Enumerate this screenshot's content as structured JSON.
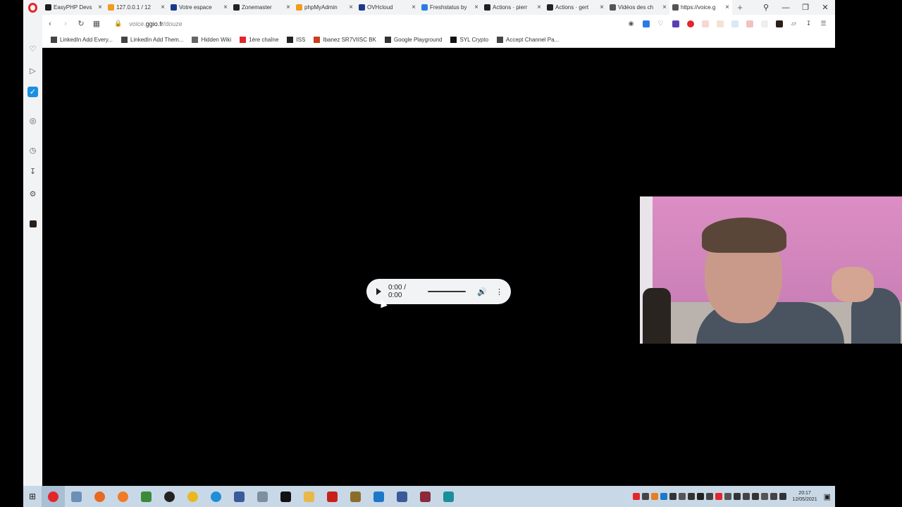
{
  "tabs": [
    {
      "label": "EasyPHP Devs",
      "color": "#1c1c1c",
      "active": false
    },
    {
      "label": "127.0.0.1 / 12",
      "color": "#f29b1d",
      "active": false
    },
    {
      "label": "Votre espace",
      "color": "#1b3a8a",
      "active": false
    },
    {
      "label": "Zonemaster",
      "color": "#222222",
      "active": false
    },
    {
      "label": "phpMyAdmin",
      "color": "#f29b1d",
      "active": false
    },
    {
      "label": "OVHcloud",
      "color": "#1b3a8a",
      "active": false
    },
    {
      "label": "Freshstatus by",
      "color": "#2c7be5",
      "active": false
    },
    {
      "label": "Actions · pierr",
      "color": "#222222",
      "active": false
    },
    {
      "label": "Actions · gert",
      "color": "#222222",
      "active": false
    },
    {
      "label": "Vidéos des ch",
      "color": "#555555",
      "active": false
    },
    {
      "label": "https://voice.g",
      "color": "#555555",
      "active": true
    }
  ],
  "address": {
    "url_prefix": "voice.",
    "url_domain": "ggio.fr",
    "url_path": "/douze"
  },
  "bookmarks": [
    {
      "label": "LinkedIn Add Every...",
      "color": "#444444"
    },
    {
      "label": "LinkedIn Add Them...",
      "color": "#444444"
    },
    {
      "label": "Hidden Wiki",
      "color": "#666666"
    },
    {
      "label": "1ère chaîne",
      "color": "#e3262b"
    },
    {
      "label": "ISS",
      "color": "#222222"
    },
    {
      "label": "Ibanez SR7VIISC BK",
      "color": "#c9401f"
    },
    {
      "label": "Google Playground",
      "color": "#333333"
    },
    {
      "label": "SYL Crypto",
      "color": "#111111"
    },
    {
      "label": "Accept Channel Pa...",
      "color": "#444444"
    }
  ],
  "audio_player": {
    "time": "0:00 / 0:00"
  },
  "taskbar": {
    "time": "20:17",
    "date": "12/05/2021"
  }
}
